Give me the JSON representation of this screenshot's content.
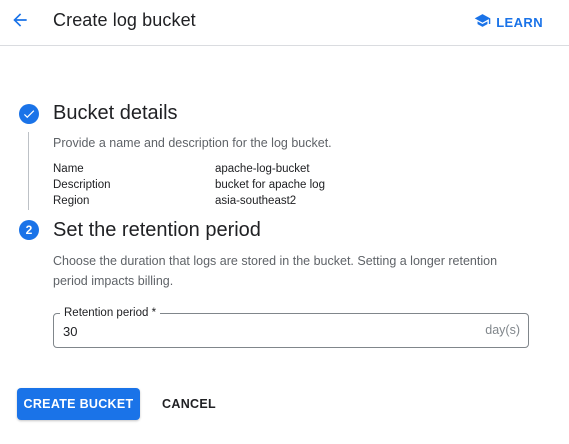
{
  "header": {
    "title": "Create log bucket",
    "learn_label": "LEARN"
  },
  "step1": {
    "title": "Bucket details",
    "description": "Provide a name and description for the log bucket.",
    "details": [
      {
        "key": "Name",
        "value": "apache-log-bucket"
      },
      {
        "key": "Description",
        "value": "bucket for apache log"
      },
      {
        "key": "Region",
        "value": "asia-southeast2"
      }
    ]
  },
  "step2": {
    "number": "2",
    "title": "Set the retention period",
    "description": "Choose the duration that logs are stored in the bucket. Setting a longer retention period impacts billing."
  },
  "retention_field": {
    "label": "Retention period *",
    "value": "30",
    "suffix": "day(s)"
  },
  "actions": {
    "create_label": "CREATE BUCKET",
    "cancel_label": "CANCEL"
  },
  "colors": {
    "accent": "#1a73e8",
    "text": "#202124",
    "secondary_text": "#5f6368"
  }
}
